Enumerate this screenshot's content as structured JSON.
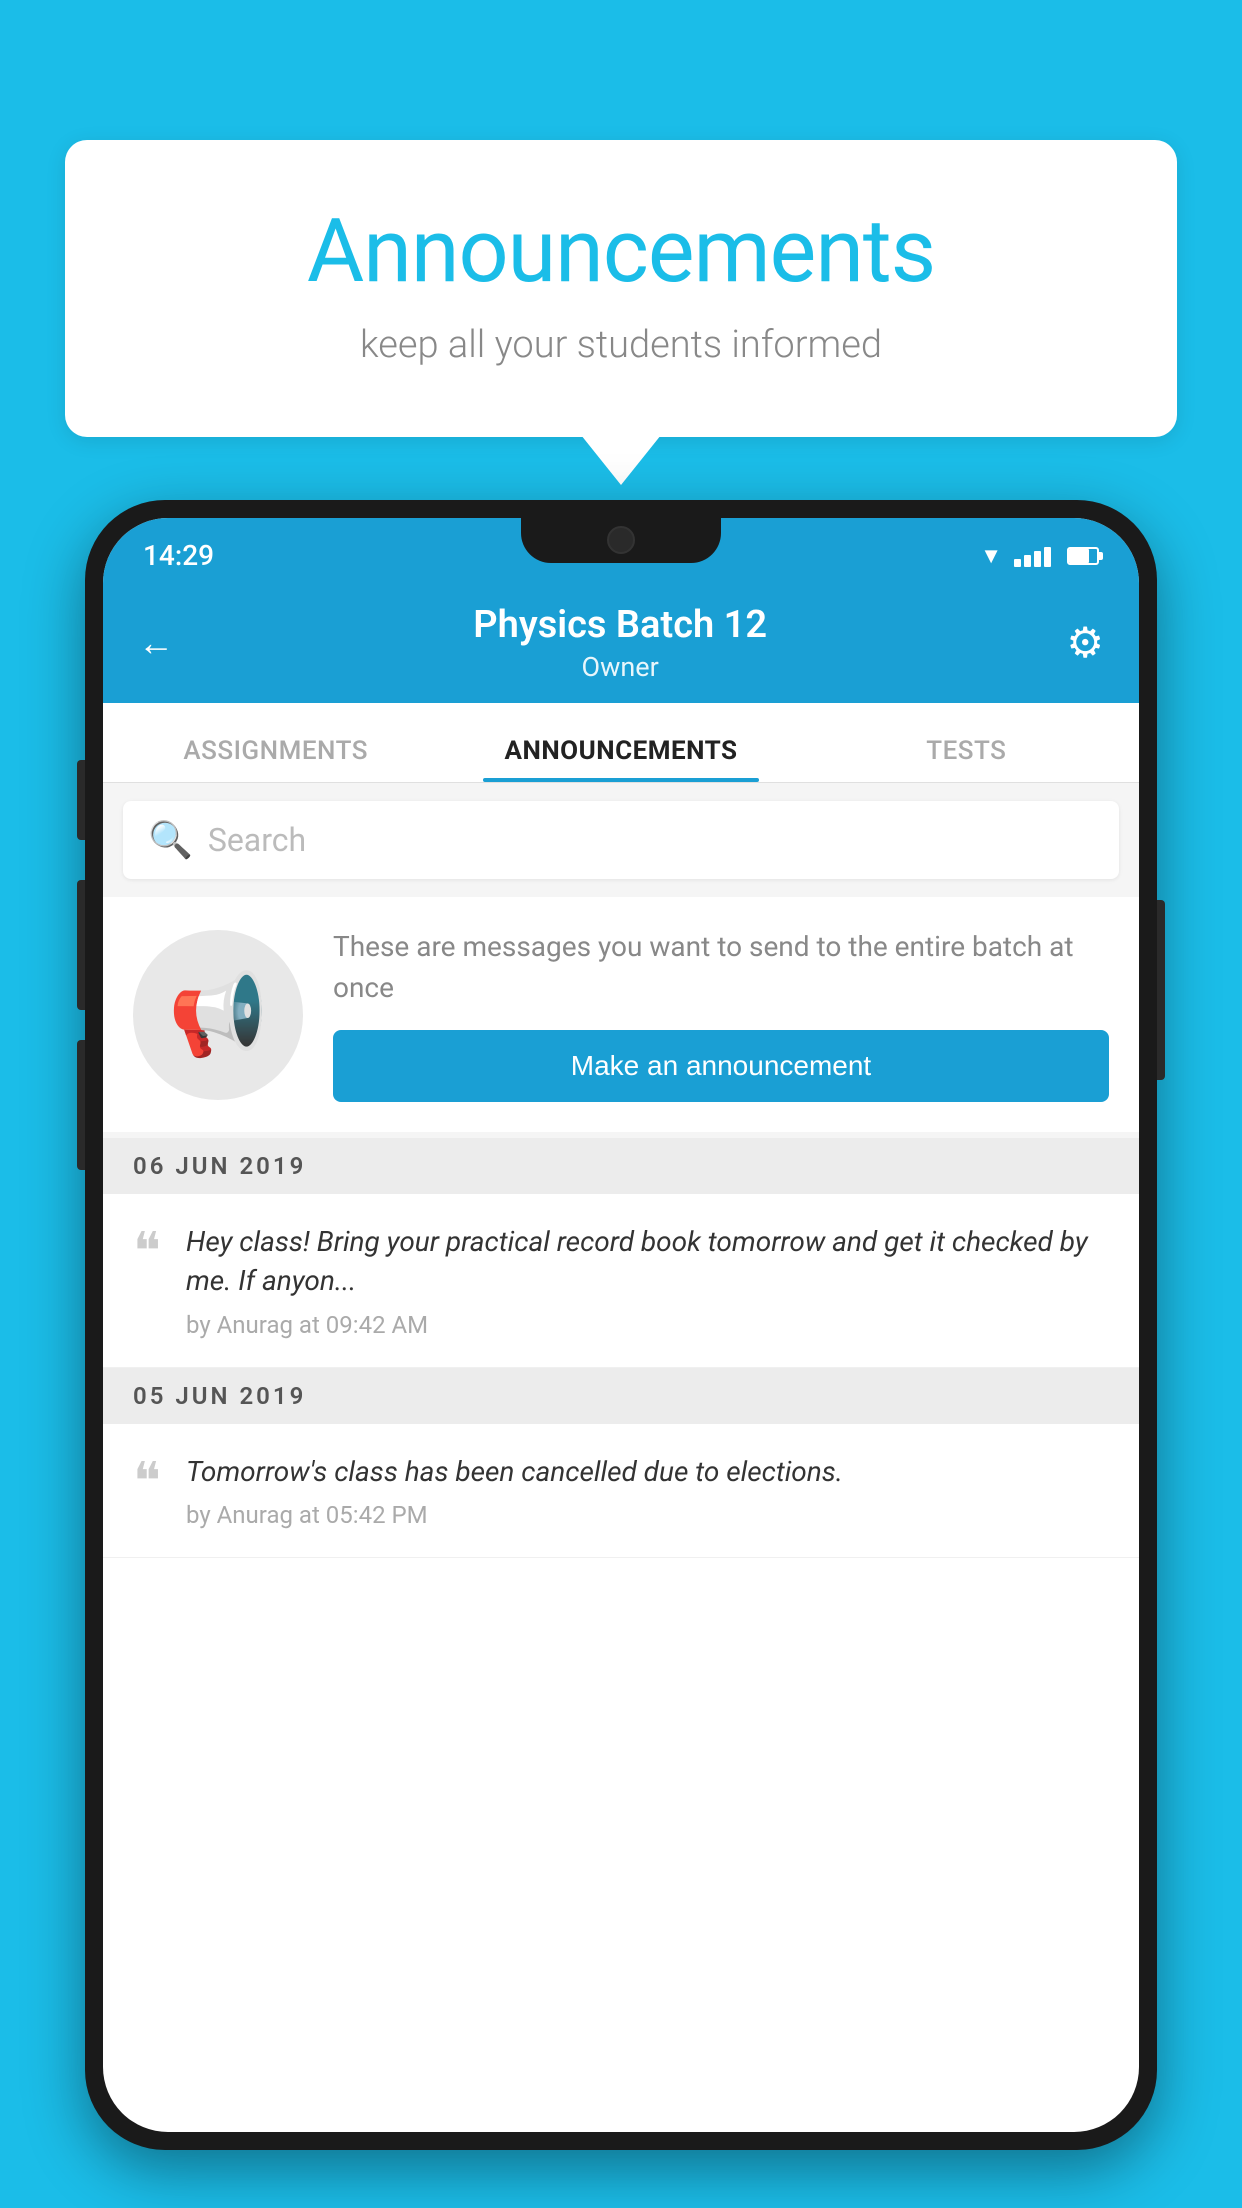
{
  "background": {
    "color": "#1BBDE8"
  },
  "speech_bubble": {
    "title": "Announcements",
    "subtitle": "keep all your students informed"
  },
  "status_bar": {
    "time": "14:29"
  },
  "app_header": {
    "title": "Physics Batch 12",
    "subtitle": "Owner",
    "back_label": "←",
    "gear_label": "⚙"
  },
  "tabs": [
    {
      "label": "ASSIGNMENTS",
      "active": false
    },
    {
      "label": "ANNOUNCEMENTS",
      "active": true
    },
    {
      "label": "TESTS",
      "active": false
    }
  ],
  "search": {
    "placeholder": "Search"
  },
  "promo": {
    "description": "These are messages you want to send to the entire batch at once",
    "button_label": "Make an announcement"
  },
  "date_groups": [
    {
      "date": "06  JUN  2019",
      "announcements": [
        {
          "message": "Hey class! Bring your practical record book tomorrow and get it checked by me. If anyon...",
          "meta": "by Anurag at 09:42 AM"
        }
      ]
    },
    {
      "date": "05  JUN  2019",
      "announcements": [
        {
          "message": "Tomorrow's class has been cancelled due to elections.",
          "meta": "by Anurag at 05:42 PM"
        }
      ]
    }
  ]
}
